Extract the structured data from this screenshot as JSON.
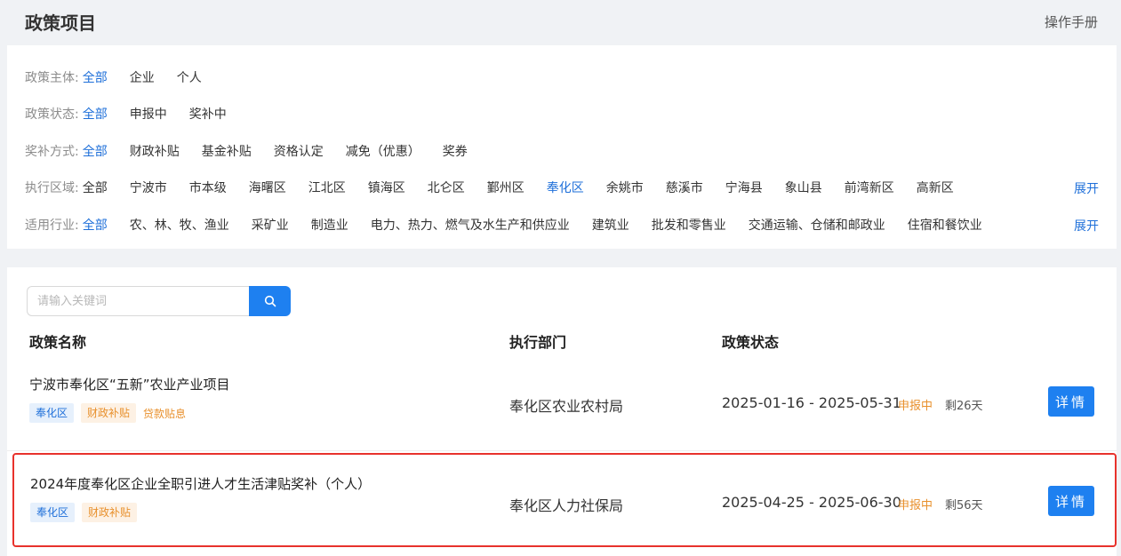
{
  "header": {
    "title": "政策项目",
    "manual": "操作手册"
  },
  "filters": {
    "subject": {
      "label": "政策主体:",
      "options": [
        "全部",
        "企业",
        "个人"
      ]
    },
    "status": {
      "label": "政策状态:",
      "options": [
        "全部",
        "申报中",
        "奖补中"
      ]
    },
    "method": {
      "label": "奖补方式:",
      "options": [
        "全部",
        "财政补贴",
        "基金补贴",
        "资格认定",
        "减免（优惠）",
        "奖券"
      ]
    },
    "region": {
      "label": "执行区域:",
      "options": [
        "全部",
        "宁波市",
        "市本级",
        "海曙区",
        "江北区",
        "镇海区",
        "北仑区",
        "鄞州区",
        "奉化区",
        "余姚市",
        "慈溪市",
        "宁海县",
        "象山县",
        "前湾新区",
        "高新区"
      ],
      "expand": "展开"
    },
    "industry": {
      "label": "适用行业:",
      "options": [
        "全部",
        "农、林、牧、渔业",
        "采矿业",
        "制造业",
        "电力、热力、燃气及水生产和供应业",
        "建筑业",
        "批发和零售业",
        "交通运输、仓储和邮政业",
        "住宿和餐饮业"
      ],
      "expand": "展开"
    }
  },
  "search": {
    "placeholder": "请输入关键词"
  },
  "columns": {
    "name": "政策名称",
    "dept": "执行部门",
    "status": "政策状态"
  },
  "rows": [
    {
      "name": "宁波市奉化区“五新”农业产业项目",
      "tag1": "奉化区",
      "tag2": "财政补贴",
      "tag3": "贷款贴息",
      "dept": "奉化区农业农村局",
      "period": "2025-01-16 - 2025-05-31",
      "status": "申报中",
      "remain": "剩26天",
      "button": "详情"
    },
    {
      "name": "2024年度奉化区企业全职引进人才生活津贴奖补（个人）",
      "tag1": "奉化区",
      "tag2": "财政补贴",
      "dept": "奉化区人力社保局",
      "period": "2025-04-25 - 2025-06-30",
      "status": "申报中",
      "remain": "剩56天",
      "button": "详情"
    }
  ],
  "colors": {
    "accent": "#1e80f0",
    "active": "#1e6fd9",
    "warning": "#e8902c",
    "highlight": "#e8322c"
  }
}
